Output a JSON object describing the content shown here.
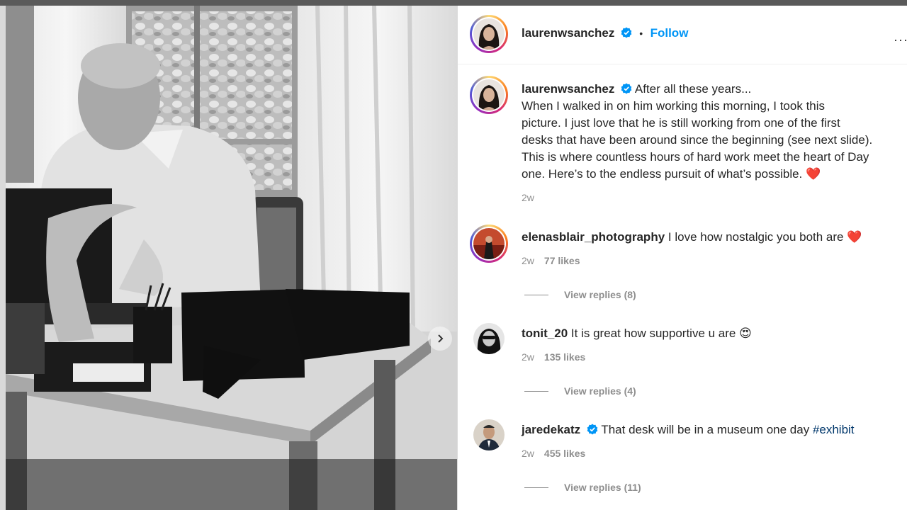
{
  "post": {
    "author": "laurenwsanchez",
    "follow_label": "Follow",
    "separator": "•",
    "more_label": "···",
    "caption_first": "After all these years...",
    "caption_lines": [
      "When I walked in on him working this morning, I took this",
      "picture. I just love that he is still working from one of the first",
      "desks that have been around since the beginning (see next slide).",
      "This is where countless hours of hard work meet the heart of Day",
      "one. Here’s to the endless pursuit of what’s possible. ❤️"
    ],
    "time": "2w"
  },
  "comments": [
    {
      "user": "elenasblair_photography",
      "verified": false,
      "text": "I love how nostalgic you both are ❤️",
      "time": "2w",
      "likes": "77 likes",
      "replies": "View replies (8)"
    },
    {
      "user": "tonit_20",
      "verified": false,
      "text": "It is great how supportive u are 😍",
      "time": "2w",
      "likes": "135 likes",
      "replies": "View replies (4)"
    },
    {
      "user": "jaredekatz",
      "verified": true,
      "text_before": "That desk will be in a museum one day",
      "hashtag": "#exhibit",
      "time": "2w",
      "likes": "455 likes",
      "replies": "View replies (11)"
    }
  ],
  "icons": {
    "verified": "verified-badge-icon",
    "next": "chevron-right-icon"
  },
  "colors": {
    "follow": "#0095f6",
    "verified": "#0095f6",
    "meta": "#8e8e8e",
    "hashtag": "#00376b"
  }
}
